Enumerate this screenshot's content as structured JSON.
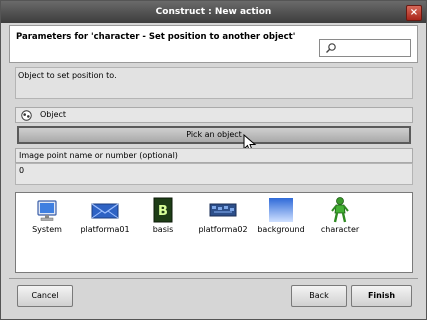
{
  "window": {
    "title": "Construct : New action",
    "close_label": "×"
  },
  "header": {
    "title": "Parameters for 'character - Set position to another object'"
  },
  "search": {
    "placeholder": ""
  },
  "description": "Object to set position to.",
  "object_param": {
    "label": "Object"
  },
  "pick_button": {
    "label": "Pick an object"
  },
  "image_point": {
    "label": "Image point name or number (optional)",
    "value": "0"
  },
  "objects": [
    {
      "name": "System",
      "icon": "system-monitor-icon"
    },
    {
      "name": "platforma01",
      "icon": "platforma01-sprite-icon"
    },
    {
      "name": "basis",
      "icon": "basis-sprite-icon"
    },
    {
      "name": "platforma02",
      "icon": "platforma02-sprite-icon"
    },
    {
      "name": "background",
      "icon": "background-sprite-icon"
    },
    {
      "name": "character",
      "icon": "character-sprite-icon"
    }
  ],
  "footer": {
    "cancel": "Cancel",
    "back": "Back",
    "finish": "Finish"
  },
  "colors": {
    "titlebar": "#4a4a4a",
    "close_button": "#b83a2c",
    "panel_bg": "#d6d6d6"
  }
}
